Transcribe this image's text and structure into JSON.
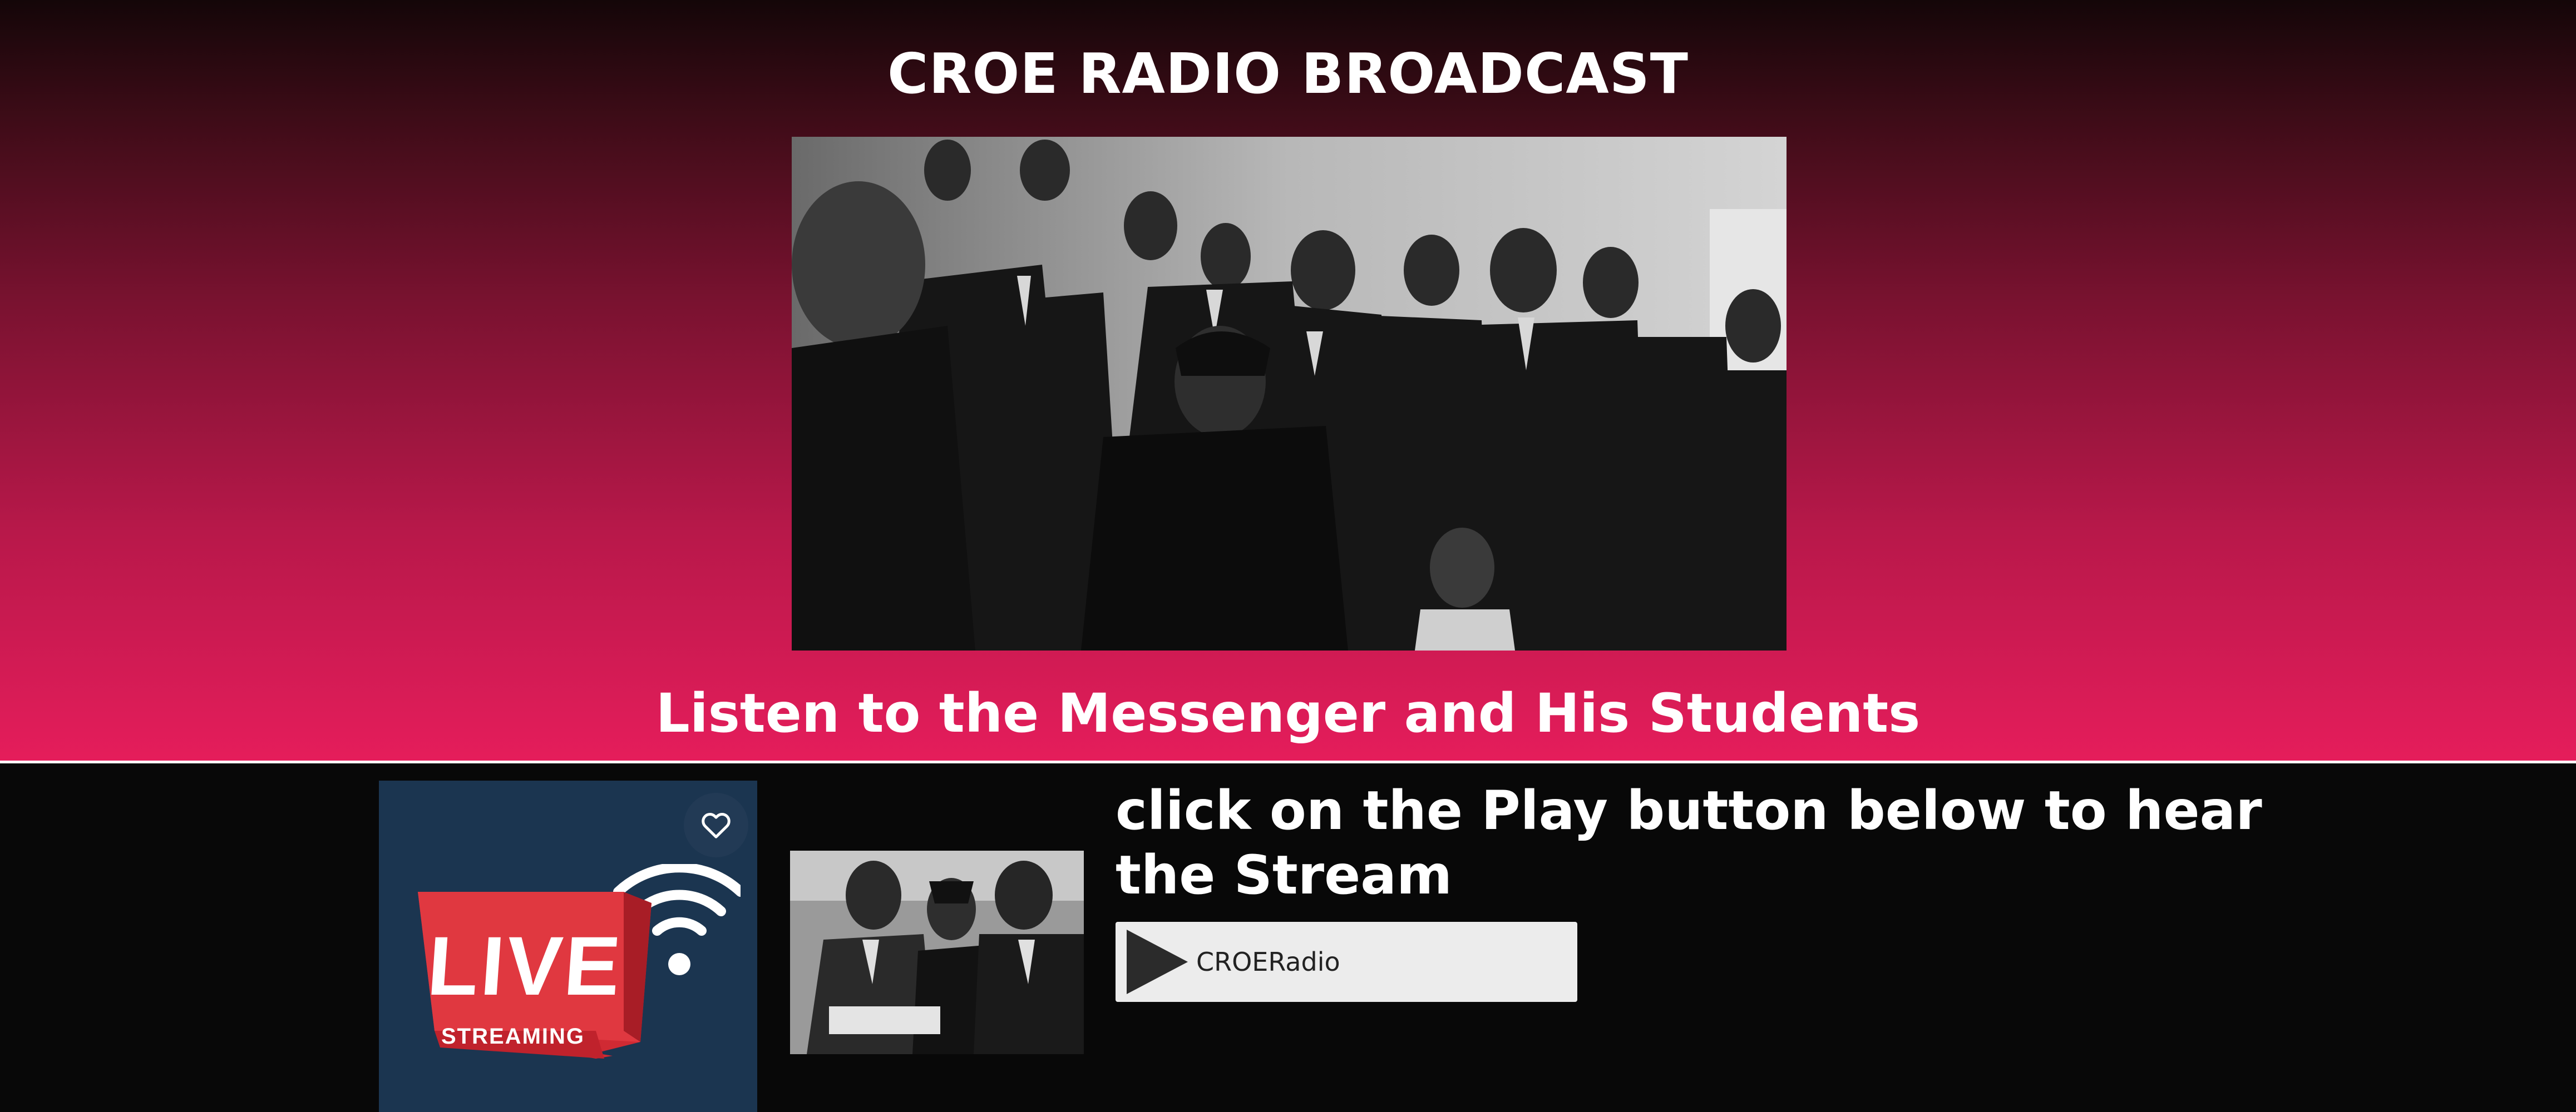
{
  "header": {
    "title": "CROE RADIO BROADCAST",
    "subtitle": "Listen to the Messenger and His Students"
  },
  "hero_image": {
    "description_icon": "group-photo-image"
  },
  "live_card": {
    "live_label": "LIVE",
    "streaming_label": "STREAMING",
    "favorite_icon": "heart-icon",
    "wifi_icon": "wifi-signal-icon"
  },
  "thumbnail": {
    "icon": "thumbnail-photo-image"
  },
  "player": {
    "instructions": "click on the Play button below to hear the Stream",
    "station_name": "CROERadio",
    "play_icon": "play-icon"
  },
  "colors": {
    "hero_gradient_top": "#140608",
    "hero_gradient_bottom": "#e51d5b",
    "page_background": "#080808",
    "live_card_background": "#1b3550",
    "live_banner_red": "#d02a33",
    "player_background": "#ececec"
  }
}
